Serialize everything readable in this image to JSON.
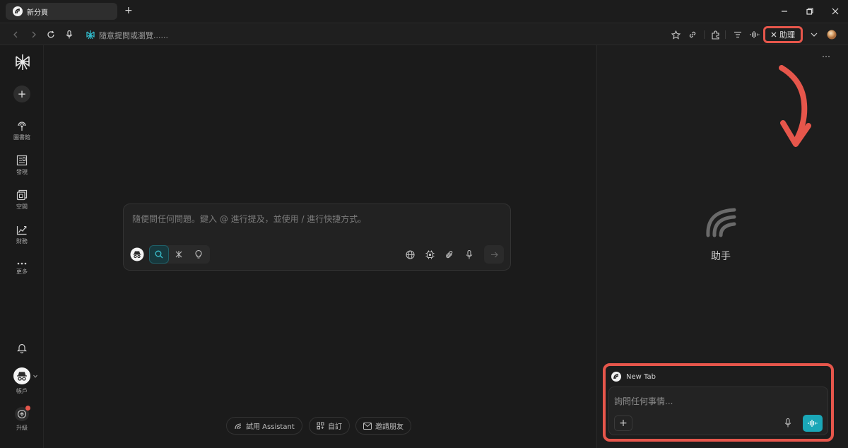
{
  "tab": {
    "title": "新分頁"
  },
  "address_bar": {
    "placeholder": "隨意提問或瀏覽......"
  },
  "toolbar": {
    "assistant_label": "助理"
  },
  "sidebar": {
    "items": [
      {
        "label": "圖書館",
        "icon": "library-icon"
      },
      {
        "label": "發現",
        "icon": "discover-icon"
      },
      {
        "label": "空間",
        "icon": "spaces-icon"
      },
      {
        "label": "財務",
        "icon": "finance-icon"
      },
      {
        "label": "更多",
        "icon": "more-icon"
      }
    ],
    "account_label": "帳戶",
    "upgrade_label": "升級"
  },
  "composer": {
    "placeholder": "隨便問任何問題。鍵入 @ 進行提及，並使用 / 進行快捷方式。"
  },
  "bottom_chips": [
    {
      "label": "試用 Assistant",
      "icon": "assistant-icon"
    },
    {
      "label": "自訂",
      "icon": "customize-icon"
    },
    {
      "label": "邀請朋友",
      "icon": "mail-icon"
    }
  ],
  "assistant_panel": {
    "title": "助手",
    "context_tab": "New Tab",
    "input_placeholder": "詢問任何事情..."
  },
  "colors": {
    "accent": "#1aa7b7",
    "highlight": "#e6564b",
    "background": "#1a1a1a"
  }
}
